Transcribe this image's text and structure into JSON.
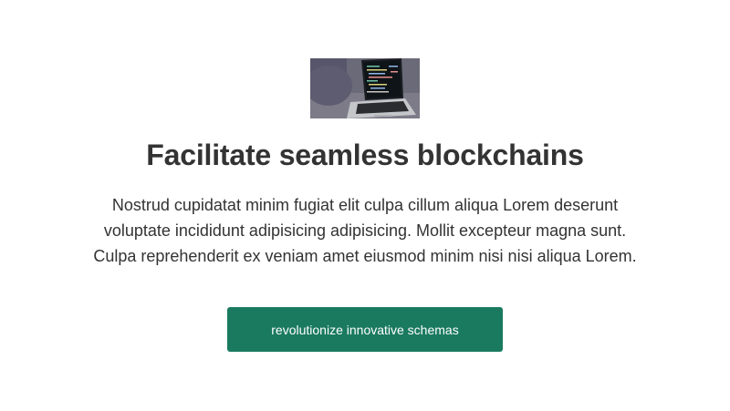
{
  "hero": {
    "image_icon": "laptop-code-photo",
    "title": "Facilitate seamless blockchains",
    "body": "Nostrud cupidatat minim fugiat elit culpa cillum aliqua Lorem deserunt voluptate incididunt adipisicing adipisicing. Mollit excepteur magna sunt. Culpa reprehenderit ex veniam amet eiusmod minim nisi nisi aliqua Lorem.",
    "cta_label": "revolutionize innovative schemas"
  },
  "colors": {
    "background": "#ffffff",
    "text": "#333333",
    "button": "#1a7a60",
    "button_text": "#ffffff"
  }
}
